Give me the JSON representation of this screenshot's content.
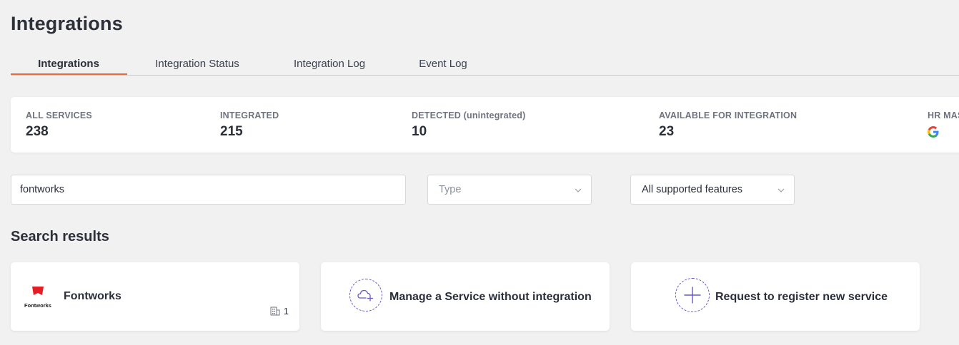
{
  "page": {
    "title": "Integrations"
  },
  "tabs": [
    {
      "label": "Integrations",
      "active": true
    },
    {
      "label": "Integration Status",
      "active": false
    },
    {
      "label": "Integration Log",
      "active": false
    },
    {
      "label": "Event Log",
      "active": false
    }
  ],
  "stats": [
    {
      "label": "ALL SERVICES",
      "value": "238"
    },
    {
      "label": "INTEGRATED",
      "value": "215"
    },
    {
      "label": "DETECTED (unintegrated)",
      "value": "10"
    },
    {
      "label": "AVAILABLE FOR INTEGRATION",
      "value": "23"
    },
    {
      "label": "HR MAS",
      "icon": "google-icon"
    }
  ],
  "filters": {
    "search_value": "fontworks",
    "type_placeholder": "Type",
    "features_value": "All supported features"
  },
  "results": {
    "title": "Search results",
    "cards": [
      {
        "name": "Fontworks",
        "logo_text": "Fontworks",
        "count": "1",
        "icon": "building-icon"
      },
      {
        "name": "Manage a Service without integration",
        "icon": "cloud-plus-icon"
      },
      {
        "name": "Request to register new service",
        "icon": "plus-icon"
      }
    ]
  },
  "colors": {
    "accent": "#ea6a3c",
    "icon_purple": "#6b55c9",
    "logo_red": "#e41f24",
    "background": "#f1f1f1"
  }
}
